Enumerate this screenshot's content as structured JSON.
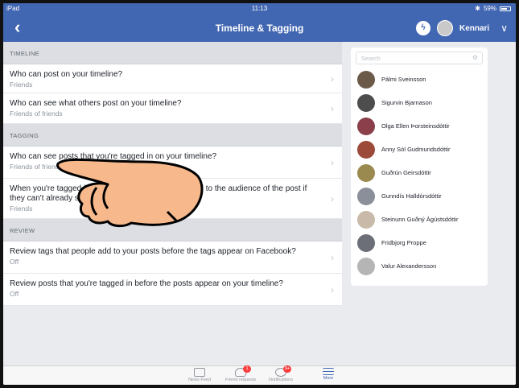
{
  "status_bar": {
    "device": "iPad",
    "time": "11:13",
    "battery": "59%"
  },
  "nav": {
    "title": "Timeline & Tagging",
    "user_name": "Kennari",
    "messenger_icon": "messenger-icon",
    "back_icon": "chevron-left-icon"
  },
  "sections": [
    {
      "header": "TIMELINE",
      "rows": [
        {
          "question": "Who can post on your timeline?",
          "answer": "Friends"
        },
        {
          "question": "Who can see what others post on your timeline?",
          "answer": "Friends of friends"
        }
      ]
    },
    {
      "header": "TAGGING",
      "rows": [
        {
          "question": "Who can see posts that you're tagged in on your timeline?",
          "answer": "Friends of friends"
        },
        {
          "question": "When you're tagged in a post, who do you want to add to the audience of the post if they can't already see it?",
          "answer": "Friends"
        }
      ]
    },
    {
      "header": "REVIEW",
      "rows": [
        {
          "question": "Review tags that people add to your posts before the tags appear on Facebook?",
          "answer": "Off"
        },
        {
          "question": "Review posts that you're tagged in before the posts appear on your timeline?",
          "answer": "Off"
        }
      ]
    }
  ],
  "friends_panel": {
    "search_placeholder": "Search",
    "friends": [
      {
        "name": "Pálmi Sveinsson",
        "color": "#6b5a48"
      },
      {
        "name": "Sigurvin Bjarnason",
        "color": "#4d4d4d"
      },
      {
        "name": "Olga Ellen Þorsteinsdóttir",
        "color": "#8a3f4a"
      },
      {
        "name": "Anny Sól Gudmundsdóttir",
        "color": "#9c4a3a"
      },
      {
        "name": "Guðrún Geirsdóttir",
        "color": "#9a8a50"
      },
      {
        "name": "Gunndís Halldórsdóttir",
        "color": "#8a8f9a"
      },
      {
        "name": "Steinunn Guðný Ágústsdóttir",
        "color": "#c8b9a8"
      },
      {
        "name": "Fridbjorg Proppe",
        "color": "#6c6f78"
      },
      {
        "name": "Valur Alexandersson",
        "color": "#b5b5b5"
      }
    ]
  },
  "tabbar": {
    "tabs": [
      {
        "label": "News Feed",
        "badge": ""
      },
      {
        "label": "Friend requests",
        "badge": "1"
      },
      {
        "label": "Notifications",
        "badge": "9+"
      },
      {
        "label": "More",
        "badge": ""
      }
    ]
  },
  "colors": {
    "brand": "#4267b2",
    "badge": "#fa3e3e"
  }
}
